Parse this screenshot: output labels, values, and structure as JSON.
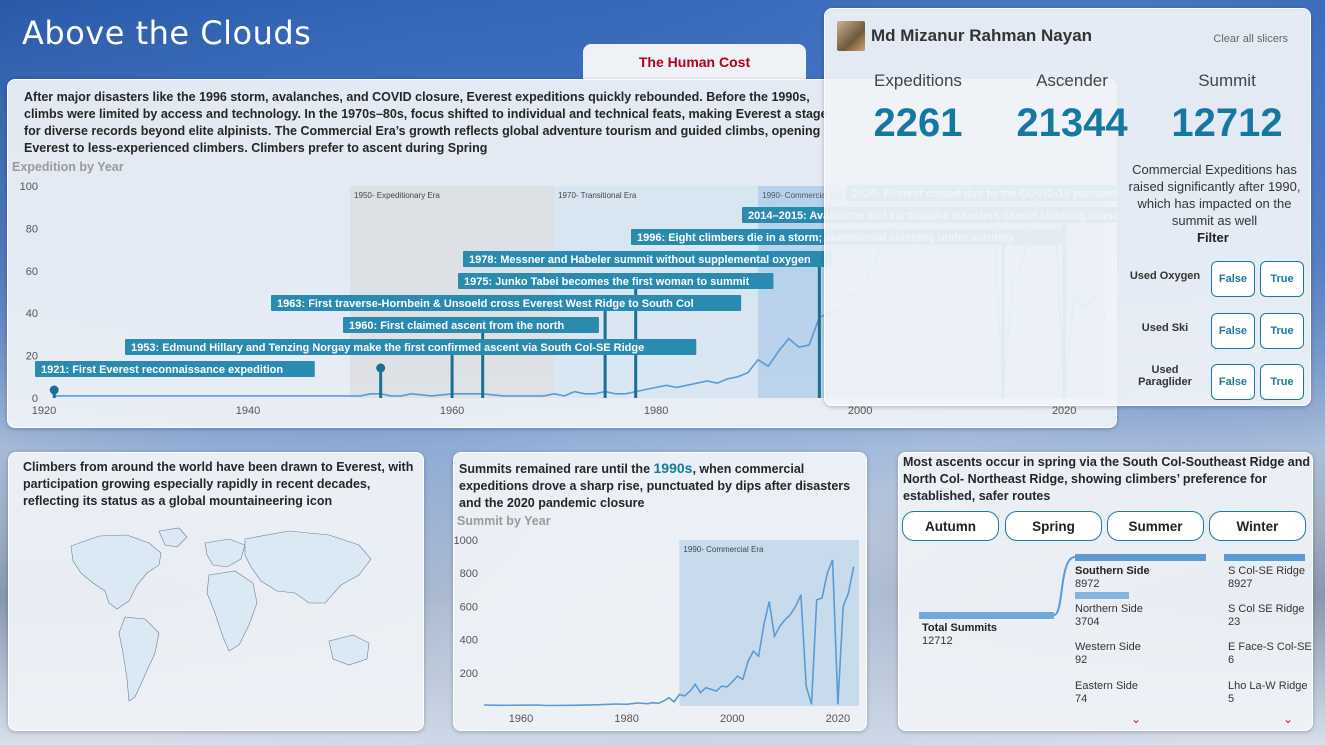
{
  "dashboard": {
    "title": "Above the Clouds"
  },
  "tab": {
    "label": "The Human Cost"
  },
  "profile": {
    "name": "Md Mizanur Rahman Nayan",
    "clear_label": "Clear all slicers"
  },
  "kpis": [
    {
      "label": "Expeditions",
      "value": "2261"
    },
    {
      "label": "Ascender",
      "value": "21344"
    },
    {
      "label": "Summit",
      "value": "12712"
    }
  ],
  "kpi_note": "Commercial Expeditions has raised significantly after 1990, which has impacted on the summit as well",
  "filter": {
    "title": "Filter",
    "rows": [
      {
        "label": "Used Oxygen",
        "options": [
          "False",
          "True"
        ]
      },
      {
        "label": "Used Ski",
        "options": [
          "False",
          "True"
        ]
      },
      {
        "label": "Used Paraglider",
        "options": [
          "False",
          "True"
        ]
      }
    ]
  },
  "main_narrative": "After major disasters like the 1996 storm, avalanches, and COVID closure, Everest expeditions quickly rebounded. Before the 1990s, climbs were limited by access and technology. In the 1970s–80s, focus shifted to individual and technical feats, making Everest a stage for diverse records beyond elite alpinists. The Commercial Era’s growth reflects global adventure tourism and guided climbs, opening Everest to less-experienced climbers. Climbers prefer to ascent during Spring",
  "map_narrative": "Climbers from around the world have been drawn to Everest, with participation growing especially rapidly in recent decades, reflecting its status as a global mountaineering icon",
  "summit_narrative": {
    "before": "Summits remained rare until the ",
    "highlight": "1990s",
    "after": ", when commercial expeditions drove a sharp rise, punctuated by dips after disasters and the 2020 pandemic closure"
  },
  "route_narrative": "Most ascents occur in spring via the South Col-Southeast Ridge and North Col- Northeast Ridge, showing climbers’ preference for established, safer routes",
  "seasons": [
    "Autumn",
    "Spring",
    "Summer",
    "Winter"
  ],
  "decomp": {
    "root": {
      "label": "Total Summits",
      "value": "12712"
    },
    "level1": [
      {
        "label": "Southern Side",
        "value": "8972"
      },
      {
        "label": "Northern Side",
        "value": "3704"
      },
      {
        "label": "Western Side",
        "value": "92"
      },
      {
        "label": "Eastern Side",
        "value": "74"
      }
    ],
    "level2": [
      {
        "label": "S Col-SE Ridge",
        "value": "8927"
      },
      {
        "label": "S Col SE Ridge",
        "value": "23"
      },
      {
        "label": "E Face-S Col-SE",
        "value": "6"
      },
      {
        "label": "Lho La-W Ridge",
        "value": "5"
      }
    ]
  },
  "colors": {
    "accent": "#1678a0",
    "line": "#5b9bd5",
    "tab_text": "#b00020"
  },
  "chart_data": [
    {
      "type": "line",
      "title": "Expedition by Year",
      "xlim": [
        1920,
        2024
      ],
      "ylim": [
        0,
        100
      ],
      "x_ticks": [
        1920,
        1940,
        1960,
        1980,
        2000,
        2020
      ],
      "y_ticks": [
        0,
        20,
        40,
        60,
        80,
        100
      ],
      "eras": [
        {
          "label": "1950- Expeditionary Era",
          "from": 1950,
          "to": 1970
        },
        {
          "label": "1970- Transitional Era",
          "from": 1970,
          "to": 1990
        },
        {
          "label": "1990- Commercial Era",
          "from": 1990,
          "to": 2024
        }
      ],
      "series": [
        {
          "x": [
            1921,
            1922,
            1924,
            1933,
            1935,
            1936,
            1938,
            1950,
            1951,
            1952,
            1953,
            1954,
            1955,
            1956,
            1958,
            1960,
            1962,
            1963,
            1965,
            1969,
            1970,
            1971,
            1972,
            1973,
            1974,
            1975,
            1976,
            1977,
            1978,
            1979,
            1980,
            1981,
            1982,
            1983,
            1984,
            1985,
            1986,
            1987,
            1988,
            1989,
            1990,
            1991,
            1992,
            1993,
            1994,
            1995,
            1996,
            1997,
            1998,
            1999,
            2000,
            2001,
            2002,
            2003,
            2004,
            2005,
            2006,
            2007,
            2008,
            2009,
            2010,
            2011,
            2012,
            2013,
            2014,
            2015,
            2016,
            2017,
            2018,
            2019,
            2020,
            2021,
            2022,
            2023,
            2024
          ],
          "y": [
            1,
            1,
            1,
            1,
            1,
            1,
            1,
            1,
            1,
            2,
            2,
            1,
            1,
            2,
            1,
            2,
            2,
            2,
            1,
            1,
            2,
            1,
            3,
            2,
            2,
            3,
            2,
            2,
            3,
            4,
            5,
            6,
            5,
            6,
            7,
            8,
            7,
            9,
            10,
            12,
            18,
            15,
            22,
            28,
            24,
            25,
            38,
            40,
            42,
            48,
            50,
            60,
            70,
            80,
            82,
            86,
            90,
            92,
            82,
            95,
            92,
            85,
            90,
            88,
            2,
            55,
            65,
            90,
            92,
            95,
            2,
            48,
            42,
            48,
            40
          ]
        }
      ],
      "events": [
        {
          "year": 1921,
          "label": "1921: First Everest reconnaissance expedition"
        },
        {
          "year": 1953,
          "label": "1953: Edmund Hillary and Tenzing Norgay make the first confirmed ascent via South Col-SE Ridge"
        },
        {
          "year": 1960,
          "label": "1960: First claimed ascent from the north"
        },
        {
          "year": 1963,
          "label": "1963: First traverse-Hornbein & Unsoeld cross Everest West Ridge to South Col"
        },
        {
          "year": 1975,
          "label": "1975: Junko Tabei becomes the first woman to summit"
        },
        {
          "year": 1978,
          "label": "1978: Messner and Habeler summit without supplemental oxygen"
        },
        {
          "year": 1996,
          "label": "1996: Eight climbers die in a storm; commercial climbing under scrutiny"
        },
        {
          "year": 2014,
          "label": "2014–2015: Avalanche and earthquake disasters cancel climbing seasons"
        },
        {
          "year": 2020,
          "label": "2020: Everest closed due to the COVID-19 pandemic"
        }
      ]
    },
    {
      "type": "line",
      "title": "Summit by Year",
      "xlim": [
        1953,
        2024
      ],
      "ylim": [
        0,
        1000
      ],
      "x_ticks": [
        1960,
        1980,
        2000,
        2020
      ],
      "y_ticks": [
        200,
        400,
        600,
        800,
        1000
      ],
      "eras": [
        {
          "label": "1990- Commercial Era",
          "from": 1990,
          "to": 2024
        }
      ],
      "series": [
        {
          "x": [
            1953,
            1956,
            1960,
            1963,
            1965,
            1970,
            1975,
            1978,
            1980,
            1982,
            1984,
            1985,
            1986,
            1987,
            1988,
            1989,
            1990,
            1991,
            1992,
            1993,
            1994,
            1995,
            1996,
            1997,
            1998,
            1999,
            2000,
            2001,
            2002,
            2003,
            2004,
            2005,
            2006,
            2007,
            2008,
            2009,
            2010,
            2011,
            2012,
            2013,
            2014,
            2015,
            2016,
            2017,
            2018,
            2019,
            2020,
            2021,
            2022,
            2023
          ],
          "y": [
            6,
            4,
            5,
            6,
            3,
            4,
            8,
            12,
            10,
            18,
            14,
            20,
            16,
            30,
            50,
            25,
            70,
            60,
            90,
            130,
            80,
            110,
            100,
            90,
            120,
            115,
            145,
            180,
            160,
            270,
            330,
            300,
            490,
            630,
            420,
            480,
            520,
            550,
            600,
            670,
            120,
            10,
            640,
            650,
            800,
            880,
            10,
            600,
            680,
            840
          ]
        }
      ]
    }
  ]
}
